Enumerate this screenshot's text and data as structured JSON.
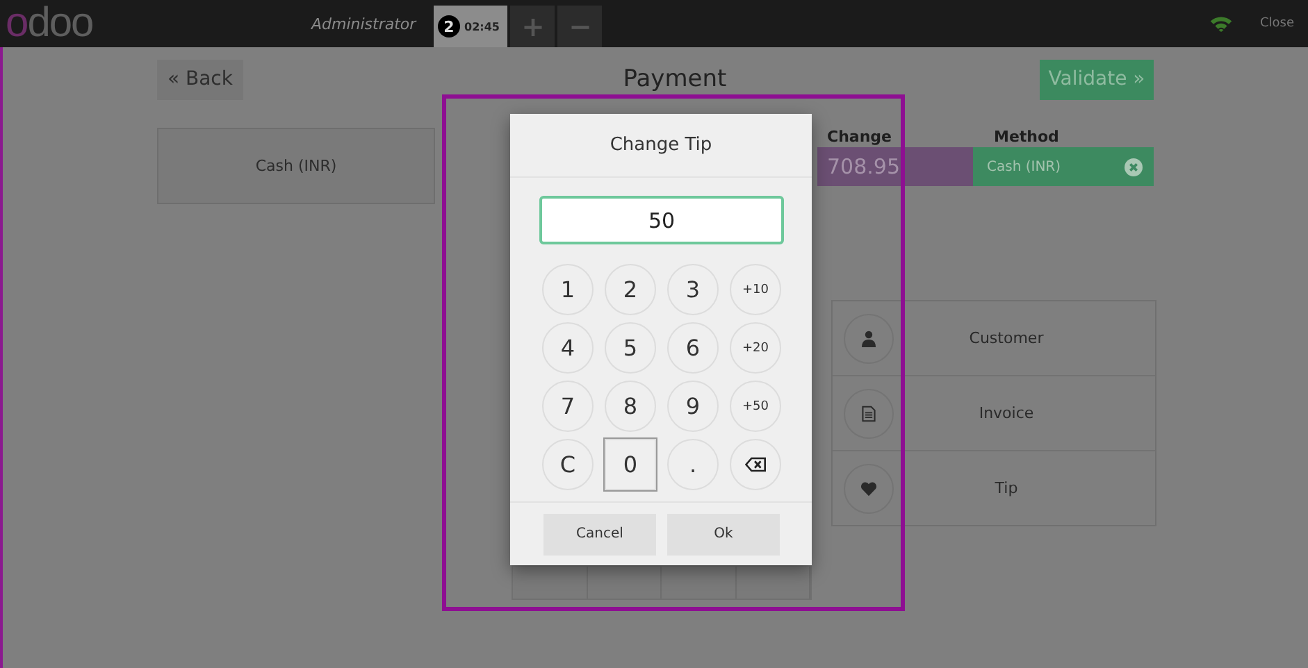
{
  "header": {
    "logo": "odoo",
    "user": "Administrator",
    "order_tabs": [
      {
        "badge": "2",
        "time": "02:45",
        "selected": true
      }
    ],
    "add_button": "+",
    "remove_button": "−",
    "close": "Close"
  },
  "payment": {
    "back_button": "« Back",
    "title": "Payment",
    "validate_button": "Validate »",
    "methods": [
      "Cash (INR)"
    ],
    "lines": {
      "columns": [
        "Change",
        "Method"
      ],
      "rows": [
        {
          "change": "708.95",
          "method": "Cash (INR)"
        }
      ]
    },
    "actions": [
      {
        "label": "Customer",
        "kind": "customer"
      },
      {
        "label": "Invoice",
        "kind": "invoice"
      },
      {
        "label": "Tip",
        "kind": "tip"
      }
    ]
  },
  "dialog": {
    "title": "Change Tip",
    "value": "50",
    "keys": [
      {
        "kind": "key",
        "label": "1",
        "focused": false
      },
      {
        "kind": "key",
        "label": "2",
        "focused": false
      },
      {
        "kind": "key",
        "label": "3",
        "focused": false
      },
      {
        "kind": "increment",
        "label": "+10",
        "focused": false
      },
      {
        "kind": "key",
        "label": "4",
        "focused": false
      },
      {
        "kind": "key",
        "label": "5",
        "focused": false
      },
      {
        "kind": "key",
        "label": "6",
        "focused": false
      },
      {
        "kind": "increment",
        "label": "+20",
        "focused": false
      },
      {
        "kind": "key",
        "label": "7",
        "focused": false
      },
      {
        "kind": "key",
        "label": "8",
        "focused": false
      },
      {
        "kind": "key",
        "label": "9",
        "focused": false
      },
      {
        "kind": "increment",
        "label": "+50",
        "focused": false
      },
      {
        "kind": "key",
        "label": "C",
        "focused": false
      },
      {
        "kind": "key",
        "label": "0",
        "focused": true
      },
      {
        "kind": "key",
        "label": ".",
        "focused": false
      },
      {
        "kind": "backspace",
        "focused": false
      }
    ],
    "buttons": [
      "Cancel",
      "Ok"
    ]
  }
}
